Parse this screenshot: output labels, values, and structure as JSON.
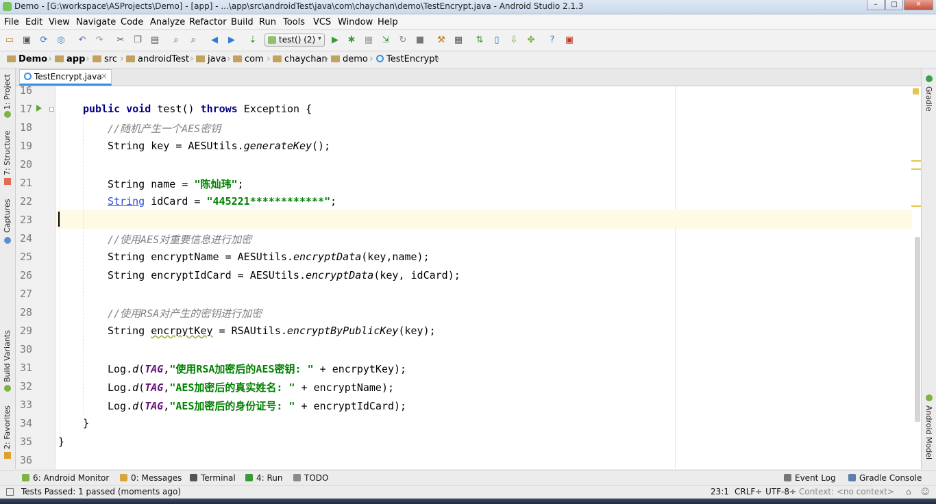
{
  "window": {
    "title": "Demo - [G:\\workspace\\ASProjects\\Demo] - [app] - ...\\app\\src\\androidTest\\java\\com\\chaychan\\demo\\TestEncrypt.java - Android Studio 2.1.3",
    "minimize": "–",
    "maximize": "□",
    "close": "✕"
  },
  "menu": [
    "File",
    "Edit",
    "View",
    "Navigate",
    "Code",
    "Analyze",
    "Refactor",
    "Build",
    "Run",
    "Tools",
    "VCS",
    "Window",
    "Help"
  ],
  "toolbar": {
    "run_config": "test() (2)",
    "run_config_arrow": "▾"
  },
  "breadcrumb": [
    "Demo",
    "app",
    "src",
    "androidTest",
    "java",
    "com",
    "chaychan",
    "demo",
    "TestEncrypt"
  ],
  "left_tools": [
    "1: Project",
    "7: Structure",
    "Captures",
    "Build Variants",
    "2: Favorites"
  ],
  "right_tools": [
    "Gradle",
    "Android Model"
  ],
  "editor": {
    "tab_label": "TestEncrypt.java",
    "tab_close": "×",
    "line_numbers": [
      "16",
      "17",
      "18",
      "19",
      "20",
      "21",
      "22",
      "23",
      "24",
      "25",
      "26",
      "27",
      "28",
      "29",
      "30",
      "31",
      "32",
      "33",
      "34",
      "35",
      "36"
    ],
    "code": {
      "l17": {
        "kw1": "public",
        "kw2": "void",
        "name": " test() ",
        "kw3": "throws",
        "rest": " Exception {"
      },
      "l18": "//随机产生一个AES密钥",
      "l19": {
        "pre": "String key = AESUtils.",
        "method": "generateKey",
        "post": "();"
      },
      "l21": {
        "pre": "String name = ",
        "str": "\"陈灿玮\"",
        "post": ";"
      },
      "l22": {
        "type": "String",
        "pre": " idCard = ",
        "str": "\"445221************\"",
        "post": ";"
      },
      "l24": "//使用AES对重要信息进行加密",
      "l25": {
        "pre": "String encryptName = AESUtils.",
        "method": "encryptData",
        "post": "(key,name);"
      },
      "l26": {
        "pre": "String encryptIdCard = AESUtils.",
        "method": "encryptData",
        "post": "(key, idCard);"
      },
      "l28": "//使用RSA对产生的密钥进行加密",
      "l29": {
        "pre": "String ",
        "var": "encrpytKey",
        "mid": " = RSAUtils.",
        "method": "encryptByPublicKey",
        "post": "(key);"
      },
      "l31": {
        "pre": "Log.",
        "m": "d",
        "open": "(",
        "tag": "TAG",
        "comma": ",",
        "str": "\"使用RSA加密后的AES密钥: \"",
        "post": " + encrpytKey);"
      },
      "l32": {
        "pre": "Log.",
        "m": "d",
        "open": "(",
        "tag": "TAG",
        "comma": ",",
        "str": "\"AES加密后的真实姓名: \"",
        "post": " + encryptName);"
      },
      "l33": {
        "pre": "Log.",
        "m": "d",
        "open": "(",
        "tag": "TAG",
        "comma": ",",
        "str": "\"AES加密后的身份证号: \"",
        "post": " + encryptIdCard);"
      },
      "l34": "}",
      "l35": "}"
    }
  },
  "bottom_tools": {
    "android_monitor": "6: Android Monitor",
    "messages": "0: Messages",
    "terminal": "Terminal",
    "run": "4: Run",
    "todo": "TODO",
    "event_log": "Event Log",
    "gradle_console": "Gradle Console"
  },
  "status": {
    "message": "Tests Passed: 1 passed (moments ago)",
    "position": "23:1",
    "line_sep": "CRLF÷",
    "encoding": "UTF-8÷",
    "context": "Context: <no context>"
  },
  "colors": {
    "keyword": "#000080",
    "comment": "#808080",
    "string": "#008000",
    "field": "#660e7a",
    "caret_line": "#fffae3",
    "tab_underline": "#3b8ee5"
  }
}
